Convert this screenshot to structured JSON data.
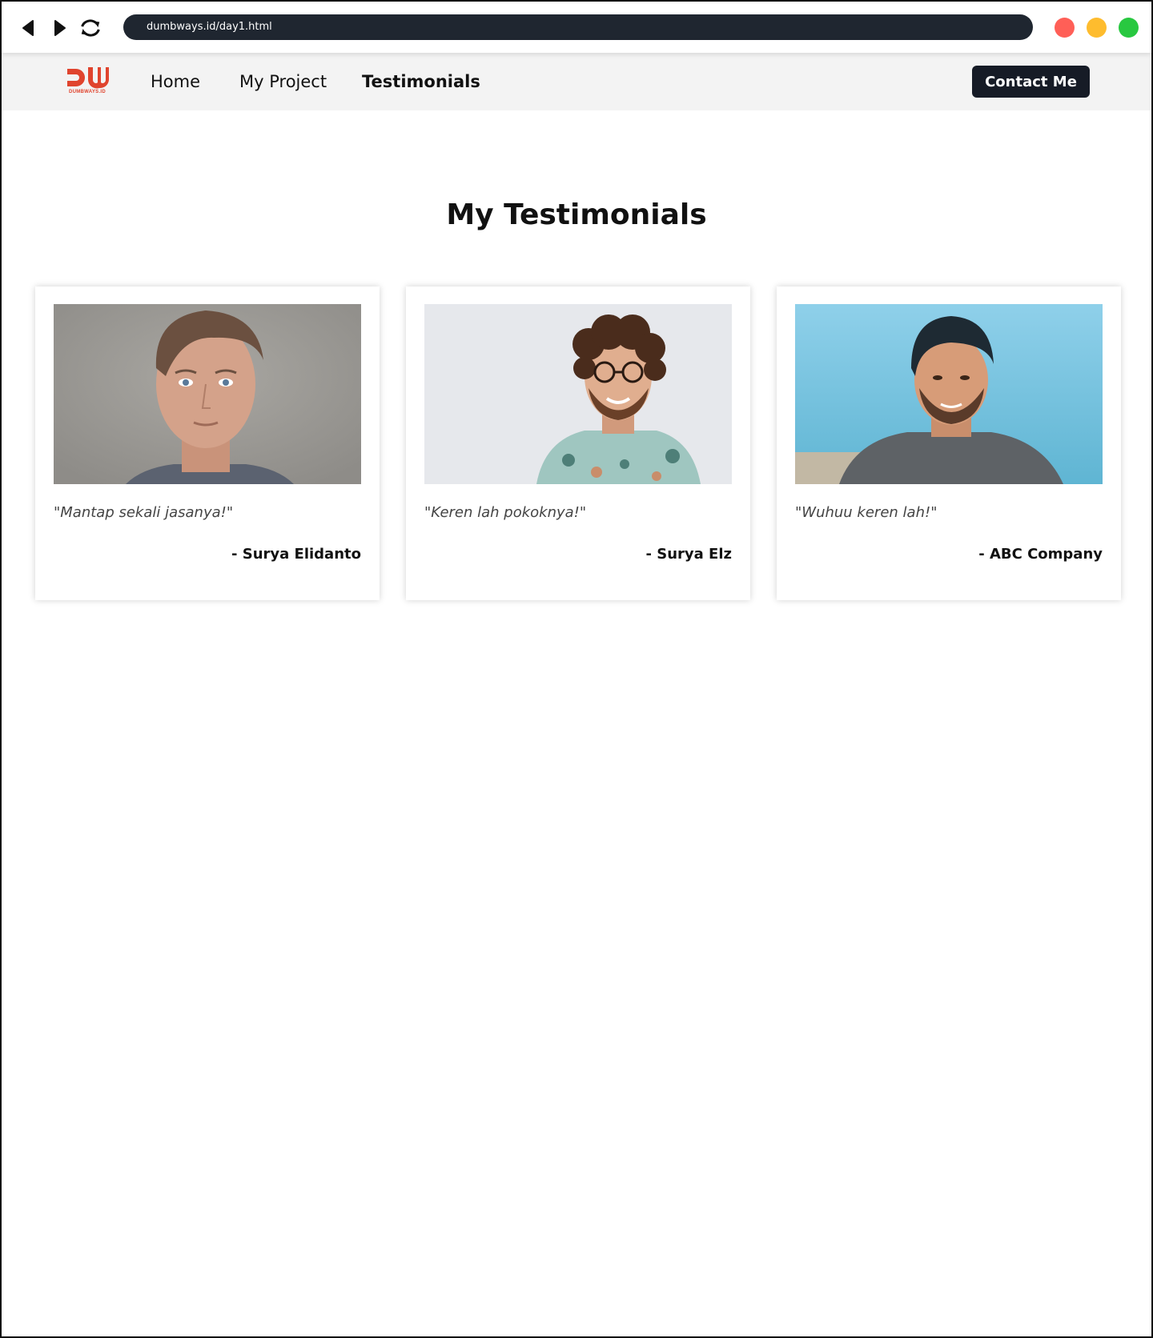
{
  "browser": {
    "url": "dumbways.id/day1.html",
    "icons": {
      "back": "back-arrow-icon",
      "forward": "forward-arrow-icon",
      "reload": "reload-icon"
    },
    "window_controls": {
      "close_color": "#ff5f57",
      "minimize_color": "#febc2e",
      "maximize_color": "#28c840"
    }
  },
  "navbar": {
    "logo_text": "DUMBWAYS.ID",
    "links": [
      {
        "label": "Home",
        "active": false
      },
      {
        "label": "My Project",
        "active": false
      },
      {
        "label": "Testimonials",
        "active": true
      }
    ],
    "contact_label": "Contact Me"
  },
  "page": {
    "title": "My Testimonials"
  },
  "testimonials": [
    {
      "quote": "\"Mantap sekali jasanya!\"",
      "author": "- Surya Elidanto"
    },
    {
      "quote": "\"Keren lah pokoknya!\"",
      "author": "- Surya Elz"
    },
    {
      "quote": "\"Wuhuu keren lah!\"",
      "author": "- ABC Company"
    }
  ],
  "colors": {
    "brand": "#e0442e",
    "button_dark": "#161b26",
    "navbar_bg": "#f3f3f3",
    "url_bar": "#1f2630"
  }
}
